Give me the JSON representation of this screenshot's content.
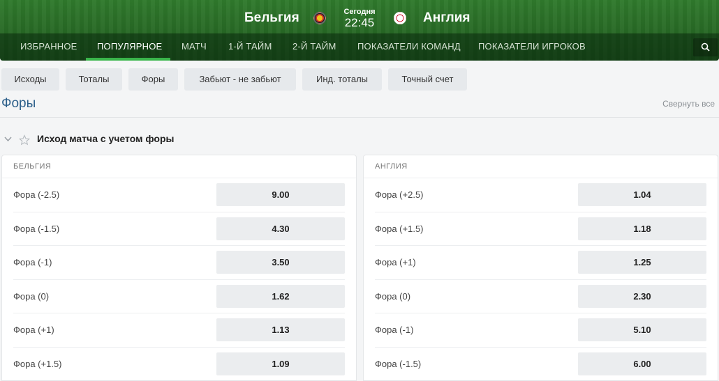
{
  "match": {
    "home_team": "Бельгия",
    "away_team": "Англия",
    "day": "Сегодня",
    "time": "22:45"
  },
  "nav": {
    "items": [
      "ИЗБРАННОЕ",
      "ПОПУЛЯРНОЕ",
      "МАТЧ",
      "1-Й ТАЙМ",
      "2-Й ТАЙМ",
      "ПОКАЗАТЕЛИ КОМАНД",
      "ПОКАЗАТЕЛИ ИГРОКОВ"
    ],
    "active": "ПОПУЛЯРНОЕ",
    "search_icon": "search-icon"
  },
  "filters": [
    "Исходы",
    "Тоталы",
    "Форы",
    "Забьют - не забьют",
    "Инд. тоталы",
    "Точный счет"
  ],
  "section": {
    "title": "Форы",
    "collapse_all": "Свернуть все"
  },
  "market": {
    "title": "Исход матча с учетом форы",
    "left": {
      "header": "БЕЛЬГИЯ",
      "rows": [
        {
          "label": "Фора (-2.5)",
          "odds": "9.00"
        },
        {
          "label": "Фора (-1.5)",
          "odds": "4.30"
        },
        {
          "label": "Фора (-1)",
          "odds": "3.50"
        },
        {
          "label": "Фора (0)",
          "odds": "1.62"
        },
        {
          "label": "Фора (+1)",
          "odds": "1.13"
        },
        {
          "label": "Фора (+1.5)",
          "odds": "1.09"
        }
      ]
    },
    "right": {
      "header": "АНГЛИЯ",
      "rows": [
        {
          "label": "Фора (+2.5)",
          "odds": "1.04"
        },
        {
          "label": "Фора (+1.5)",
          "odds": "1.18"
        },
        {
          "label": "Фора (+1)",
          "odds": "1.25"
        },
        {
          "label": "Фора (0)",
          "odds": "2.30"
        },
        {
          "label": "Фора (-1)",
          "odds": "5.10"
        },
        {
          "label": "Фора (-1.5)",
          "odds": "6.00"
        }
      ]
    }
  },
  "colors": {
    "accent": "#39b54a",
    "section_title": "#2c5f8a",
    "header_bg": "#2a6e27"
  }
}
